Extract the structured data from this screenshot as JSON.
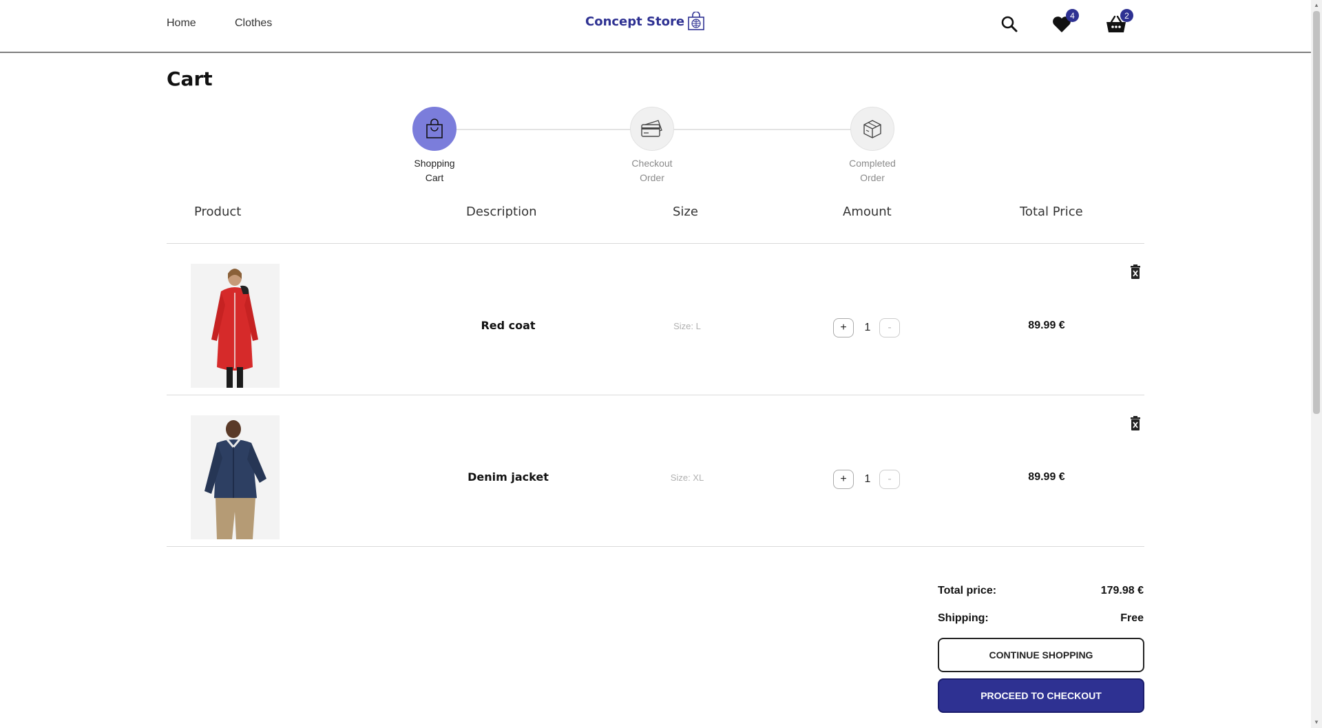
{
  "header": {
    "nav": [
      "Home",
      "Clothes"
    ],
    "brand": "Concept Store",
    "wishlist_count": "4",
    "cart_count": "2"
  },
  "page": {
    "title": "Cart"
  },
  "steps": [
    {
      "line1": "Shopping",
      "line2": "Cart",
      "active": true
    },
    {
      "line1": "Checkout",
      "line2": "Order",
      "active": false
    },
    {
      "line1": "Completed",
      "line2": "Order",
      "active": false
    }
  ],
  "table": {
    "columns": [
      "Product",
      "Description",
      "Size",
      "Amount",
      "Total Price"
    ]
  },
  "items": [
    {
      "name": "Red coat",
      "size": "Size: L",
      "qty": "1",
      "plus": "+",
      "minus": "-",
      "price": "89.99 €"
    },
    {
      "name": "Denim jacket",
      "size": "Size: XL",
      "qty": "1",
      "plus": "+",
      "minus": "-",
      "price": "89.99 €"
    }
  ],
  "summary": {
    "total_label": "Total price:",
    "total_value": "179.98 €",
    "shipping_label": "Shipping:",
    "shipping_value": "Free"
  },
  "buttons": {
    "continue": "CONTINUE SHOPPING",
    "checkout": "PROCEED TO CHECKOUT"
  },
  "colors": {
    "brand": "#2e3192",
    "active_step": "#7b7ddb"
  }
}
